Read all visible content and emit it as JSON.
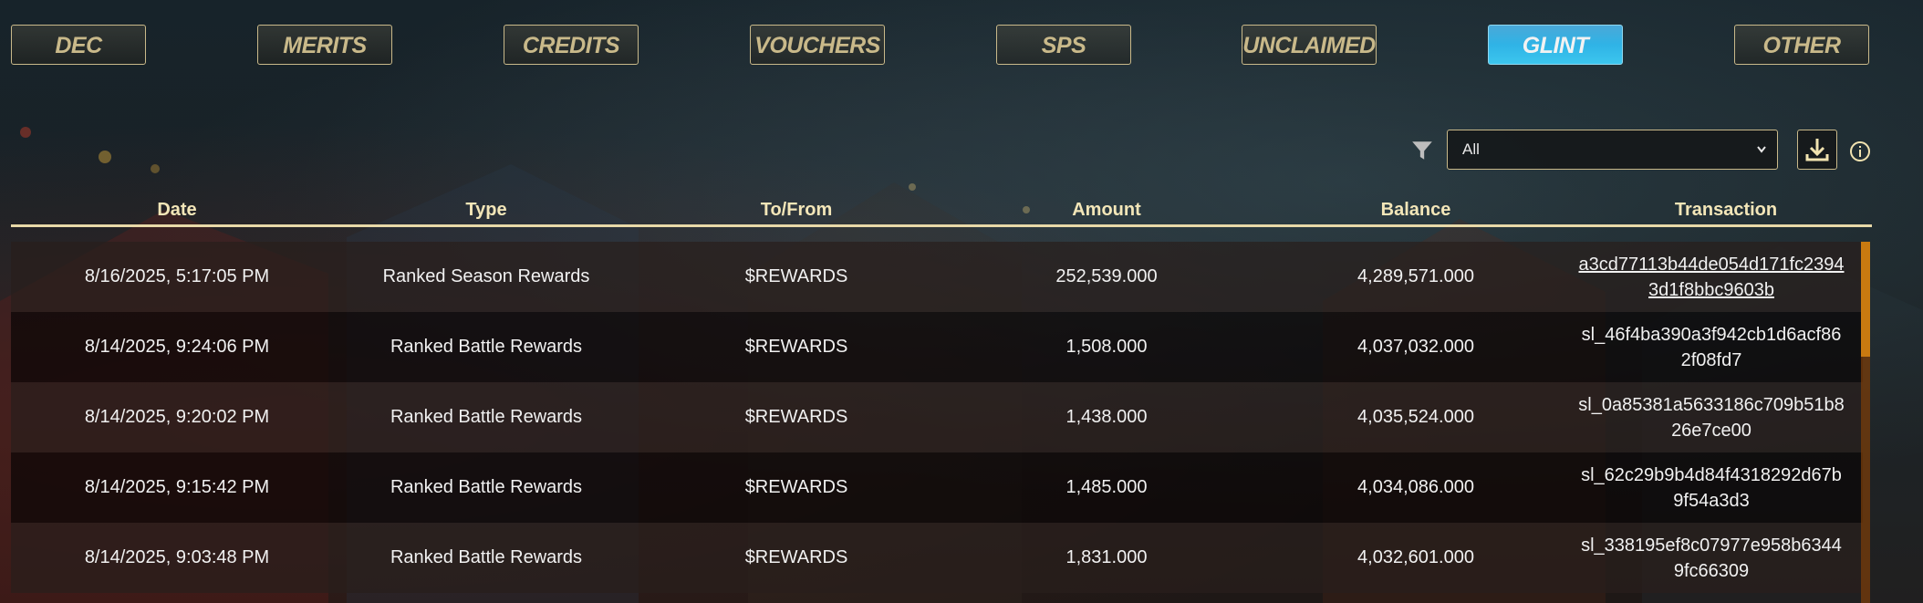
{
  "tabs": [
    {
      "label": "DEC"
    },
    {
      "label": "MERITS"
    },
    {
      "label": "CREDITS"
    },
    {
      "label": "VOUCHERS"
    },
    {
      "label": "SPS"
    },
    {
      "label": "UNCLAIMED"
    },
    {
      "label": "GLINT"
    },
    {
      "label": "OTHER"
    }
  ],
  "active_tab": "GLINT",
  "filter": {
    "selected": "All"
  },
  "table": {
    "headers": [
      "Date",
      "Type",
      "To/From",
      "Amount",
      "Balance",
      "Transaction"
    ],
    "rows": [
      {
        "date": "8/16/2025, 5:17:05 PM",
        "type": "Ranked Season Rewards",
        "to_from": "$REWARDS",
        "amount": "252,539.000",
        "balance": "4,289,571.000",
        "transaction": "a3cd77113b44de054d171fc23943d1f8bbc9603b"
      },
      {
        "date": "8/14/2025, 9:24:06 PM",
        "type": "Ranked Battle Rewards",
        "to_from": "$REWARDS",
        "amount": "1,508.000",
        "balance": "4,037,032.000",
        "transaction": "sl_46f4ba390a3f942cb1d6acf862f08fd7"
      },
      {
        "date": "8/14/2025, 9:20:02 PM",
        "type": "Ranked Battle Rewards",
        "to_from": "$REWARDS",
        "amount": "1,438.000",
        "balance": "4,035,524.000",
        "transaction": "sl_0a85381a5633186c709b51b826e7ce00"
      },
      {
        "date": "8/14/2025, 9:15:42 PM",
        "type": "Ranked Battle Rewards",
        "to_from": "$REWARDS",
        "amount": "1,485.000",
        "balance": "4,034,086.000",
        "transaction": "sl_62c29b9b4d84f4318292d67b9f54a3d3"
      },
      {
        "date": "8/14/2025, 9:03:48 PM",
        "type": "Ranked Battle Rewards",
        "to_from": "$REWARDS",
        "amount": "1,831.000",
        "balance": "4,032,601.000",
        "transaction": "sl_338195ef8c07977e958b63449fc66309"
      }
    ]
  },
  "colors": {
    "gold": "#c9b98a",
    "header_text": "#f3e6b8",
    "active_tab": "#3cc6ee",
    "scroll": "#c97a10"
  },
  "icons": {
    "filter": "filter-icon",
    "download": "download-icon",
    "info": "info-icon",
    "select_arrow": "chevron-down-icon"
  }
}
